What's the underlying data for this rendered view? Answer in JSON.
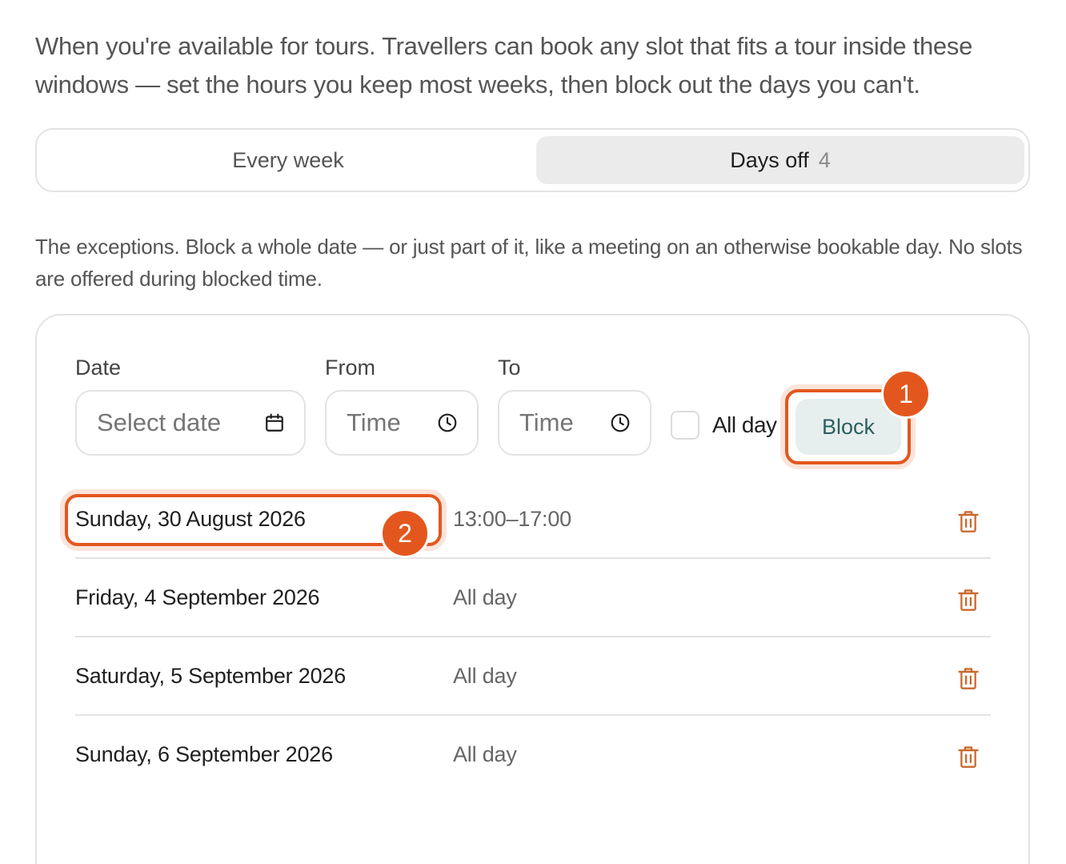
{
  "intro_text": "When you're available for tours. Travellers can book any slot that fits a tour inside these windows — set the hours you keep most weeks, then block out the days you can't.",
  "tabs": [
    {
      "label": "Every week",
      "count": "",
      "active": false
    },
    {
      "label": "Days off",
      "count": "4",
      "active": true
    }
  ],
  "description": "The exceptions. Block a whole date — or just part of it, like a meeting on an otherwise bookable day. No slots are offered during blocked time.",
  "form": {
    "date_label": "Date",
    "date_placeholder": "Select date",
    "from_label": "From",
    "from_placeholder": "Time",
    "to_label": "To",
    "to_placeholder": "Time",
    "all_day_label": "All day",
    "all_day_checked": false,
    "block_button": "Block"
  },
  "callouts": [
    "1",
    "2"
  ],
  "blocked_days": [
    {
      "date": "Sunday, 30 August 2026",
      "time": "13:00–17:00"
    },
    {
      "date": "Friday, 4 September 2026",
      "time": "All day"
    },
    {
      "date": "Saturday, 5 September 2026",
      "time": "All day"
    },
    {
      "date": "Sunday, 6 September 2026",
      "time": "All day"
    }
  ],
  "colors": {
    "accent": "#e3571e",
    "trash_icon": "#c96a2e",
    "block_button_bg": "#e6eeee",
    "block_button_text": "#2d5f60",
    "active_tab_bg": "#ebebeb"
  },
  "icons": [
    "calendar-icon",
    "clock-icon",
    "trash-icon"
  ]
}
